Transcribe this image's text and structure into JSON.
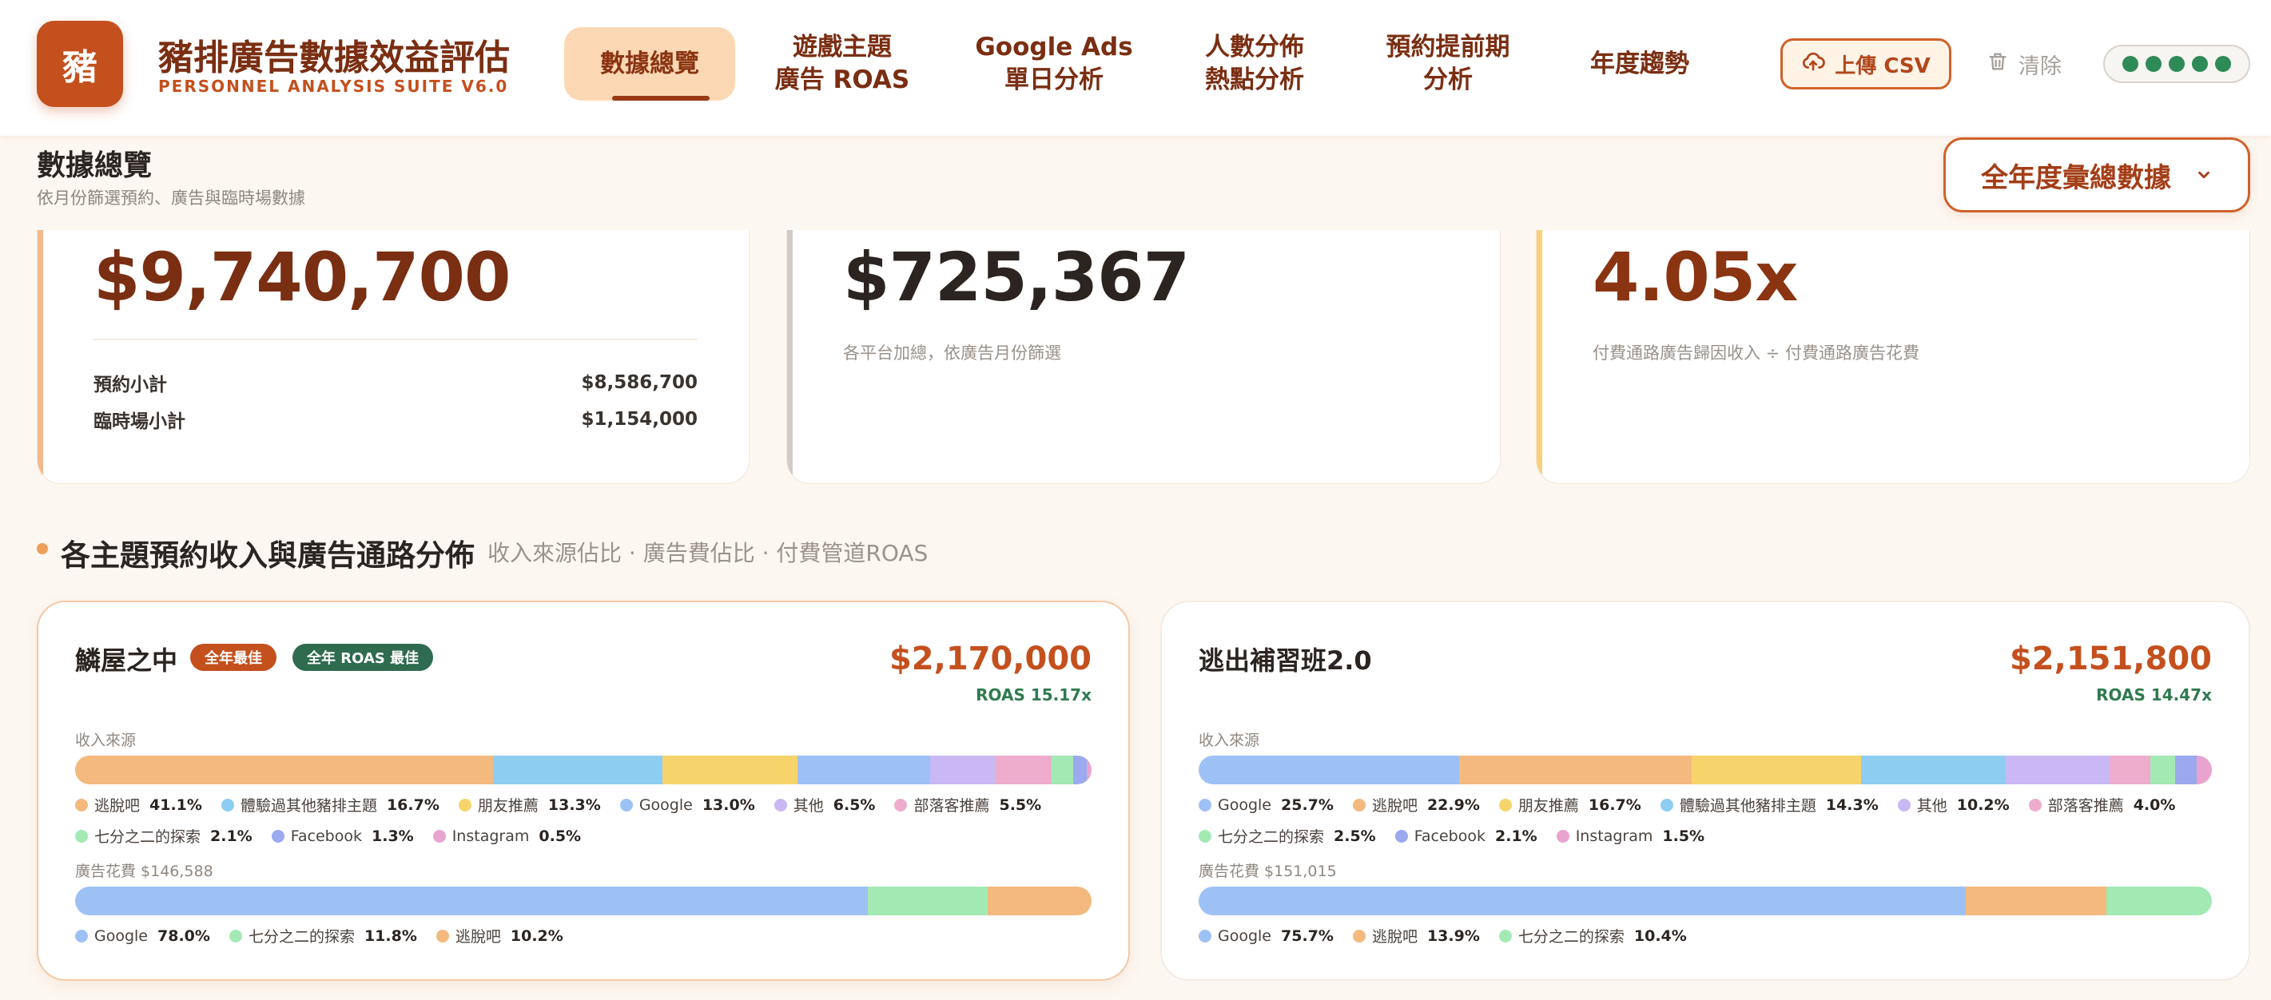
{
  "header": {
    "logo_char": "豬",
    "title": "豬排廣告數據效益評估",
    "subtitle": "PERSONNEL ANALYSIS SUITE V6.0",
    "tabs": [
      {
        "label": "數據總覽",
        "active": true
      },
      {
        "label": "遊戲主題\n廣告 ROAS",
        "active": false
      },
      {
        "label": "Google Ads\n單日分析",
        "active": false
      },
      {
        "label": "人數分佈\n熱點分析",
        "active": false
      },
      {
        "label": "預約提前期\n分析",
        "active": false
      },
      {
        "label": "年度趨勢",
        "active": false
      }
    ],
    "upload_label": "上傳 CSV",
    "clear_label": "清除",
    "status_dots": 5
  },
  "page": {
    "title": "數據總覽",
    "subtitle": "依月份篩選預約、廣告與臨時場數據",
    "period_select": "全年度彙總數據"
  },
  "kpis": [
    {
      "value": "$9,740,700",
      "color": "#7a2e12",
      "accent": "#f3b98a",
      "rows": [
        {
          "label": "預約小計",
          "value": "$8,586,700"
        },
        {
          "label": "臨時場小計",
          "value": "$1,154,000"
        }
      ]
    },
    {
      "value": "$725,367",
      "color": "#2b2420",
      "accent": "#cfcbc7",
      "note": "各平台加總，依廣告月份篩選"
    },
    {
      "value": "4.05x",
      "color": "#8a3412",
      "accent": "#f5d27a",
      "note": "付費通路廣告歸因收入 ÷ 付費通路廣告花費"
    }
  ],
  "section": {
    "title": "各主題預約收入與廣告通路分佈",
    "subtitle": "收入來源佔比 · 廣告費佔比 · 付費管道ROAS"
  },
  "themes": [
    {
      "name": "鱗屋之中",
      "badges": [
        {
          "label": "全年最佳",
          "tone": "orange"
        },
        {
          "label": "全年 ROAS 最佳",
          "tone": "green"
        }
      ],
      "total": "$2,170,000",
      "roas": "ROAS 15.17x",
      "revenue_label": "收入來源",
      "revenue": [
        {
          "name": "逃脫吧",
          "pct": 41.1,
          "pct_label": "41.1%",
          "color": "#f3b97e"
        },
        {
          "name": "體驗過其他豬排主題",
          "pct": 16.7,
          "pct_label": "16.7%",
          "color": "#8dcdf2"
        },
        {
          "name": "朋友推薦",
          "pct": 13.3,
          "pct_label": "13.3%",
          "color": "#f6d46b"
        },
        {
          "name": "Google",
          "pct": 13.0,
          "pct_label": "13.0%",
          "color": "#9ec1f5"
        },
        {
          "name": "其他",
          "pct": 6.5,
          "pct_label": "6.5%",
          "color": "#c9b8f3"
        },
        {
          "name": "部落客推薦",
          "pct": 5.5,
          "pct_label": "5.5%",
          "color": "#eeaccd"
        },
        {
          "name": "七分之二的探索",
          "pct": 2.1,
          "pct_label": "2.1%",
          "color": "#a3e9b4"
        },
        {
          "name": "Facebook",
          "pct": 1.3,
          "pct_label": "1.3%",
          "color": "#9ba9ee"
        },
        {
          "name": "Instagram",
          "pct": 0.5,
          "pct_label": "0.5%",
          "color": "#e9a3cf"
        }
      ],
      "spend_label": "廣告花費 $146,588",
      "spend": [
        {
          "name": "Google",
          "pct": 78.0,
          "pct_label": "78.0%",
          "color": "#9ec1f5"
        },
        {
          "name": "七分之二的探索",
          "pct": 11.8,
          "pct_label": "11.8%",
          "color": "#a3e9b4"
        },
        {
          "name": "逃脫吧",
          "pct": 10.2,
          "pct_label": "10.2%",
          "color": "#f3b97e"
        }
      ]
    },
    {
      "name": "逃出補習班2.0",
      "badges": [],
      "total": "$2,151,800",
      "roas": "ROAS 14.47x",
      "revenue_label": "收入來源",
      "revenue": [
        {
          "name": "Google",
          "pct": 25.7,
          "pct_label": "25.7%",
          "color": "#9ec1f5"
        },
        {
          "name": "逃脫吧",
          "pct": 22.9,
          "pct_label": "22.9%",
          "color": "#f3b97e"
        },
        {
          "name": "朋友推薦",
          "pct": 16.7,
          "pct_label": "16.7%",
          "color": "#f6d46b"
        },
        {
          "name": "體驗過其他豬排主題",
          "pct": 14.3,
          "pct_label": "14.3%",
          "color": "#8dcdf2"
        },
        {
          "name": "其他",
          "pct": 10.2,
          "pct_label": "10.2%",
          "color": "#c9b8f3"
        },
        {
          "name": "部落客推薦",
          "pct": 4.0,
          "pct_label": "4.0%",
          "color": "#eeaccd"
        },
        {
          "name": "七分之二的探索",
          "pct": 2.5,
          "pct_label": "2.5%",
          "color": "#a3e9b4"
        },
        {
          "name": "Facebook",
          "pct": 2.1,
          "pct_label": "2.1%",
          "color": "#9ba9ee"
        },
        {
          "name": "Instagram",
          "pct": 1.5,
          "pct_label": "1.5%",
          "color": "#e9a3cf"
        }
      ],
      "spend_label": "廣告花費 $151,015",
      "spend": [
        {
          "name": "Google",
          "pct": 75.7,
          "pct_label": "75.7%",
          "color": "#9ec1f5"
        },
        {
          "name": "逃脫吧",
          "pct": 13.9,
          "pct_label": "13.9%",
          "color": "#f3b97e"
        },
        {
          "name": "七分之二的探索",
          "pct": 10.4,
          "pct_label": "10.4%",
          "color": "#a3e9b4"
        }
      ]
    }
  ]
}
